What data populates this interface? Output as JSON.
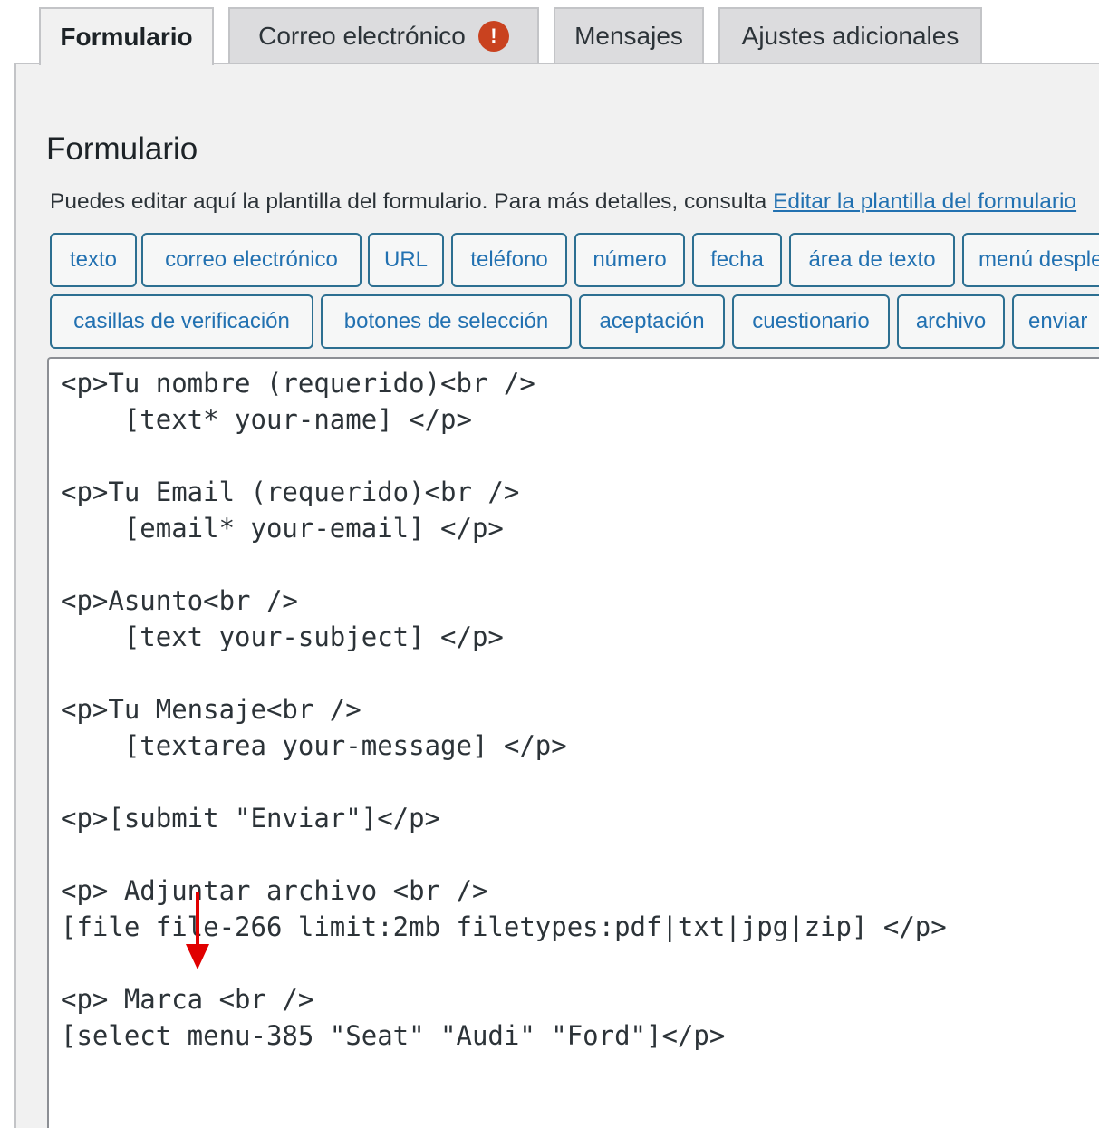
{
  "tabs": [
    {
      "label": "Formulario",
      "active": true
    },
    {
      "label": "Correo electrónico",
      "badge": "!"
    },
    {
      "label": "Mensajes"
    },
    {
      "label": "Ajustes adicionales"
    }
  ],
  "section": {
    "title": "Formulario",
    "description": "Puedes editar aquí la plantilla del formulario. Para más detalles, consulta ",
    "link_text": "Editar la plantilla del formulario"
  },
  "tag_buttons_row1": [
    "texto",
    "correo electrónico",
    "URL",
    "teléfono",
    "número",
    "fecha",
    "área de texto",
    "menú desplegable"
  ],
  "tag_buttons_row2": [
    "casillas de verificación",
    "botones de selección",
    "aceptación",
    "cuestionario",
    "archivo",
    "enviar"
  ],
  "editor": {
    "lines": [
      "<p>Tu nombre (requerido)<br />",
      "    [text* your-name] </p>",
      "",
      "<p>Tu Email (requerido)<br />",
      "    [email* your-email] </p>",
      "",
      "<p>Asunto<br />",
      "    [text your-subject] </p>",
      "",
      "<p>Tu Mensaje<br />",
      "    [textarea your-message] </p>",
      "",
      "<p>[submit \"Enviar\"]</p>",
      "",
      "<p> Adjuntar archivo <br />",
      "[file file-266 limit:2mb filetypes:pdf|txt|jpg|zip] </p>",
      "",
      "<p> Marca <br />",
      "[select menu-385 \"Seat\" \"Audi\" \"Ford\"]</p>"
    ]
  },
  "colors": {
    "accent": "#2271b1",
    "badge": "#c9421f",
    "arrow": "#e00000"
  },
  "icons": {
    "tab_badge": "exclamation-icon",
    "annotation": "red-arrow-down-icon"
  }
}
